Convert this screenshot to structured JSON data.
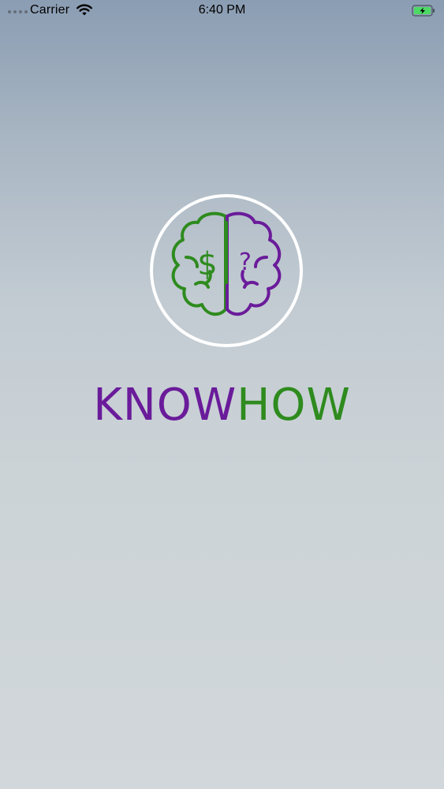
{
  "status_bar": {
    "carrier": "Carrier",
    "time": "6:40 PM",
    "battery_icon": "battery-charging-icon",
    "wifi_icon": "wifi-icon"
  },
  "brand": {
    "name_part_1": "KNOW",
    "name_part_2": "HOW",
    "logo_icon": "brain-icon",
    "logo_left_symbol": "$",
    "logo_right_symbol": "?",
    "colors": {
      "purple": "#6a1b9a",
      "green": "#2e8b1e",
      "ring": "#ffffff"
    }
  }
}
